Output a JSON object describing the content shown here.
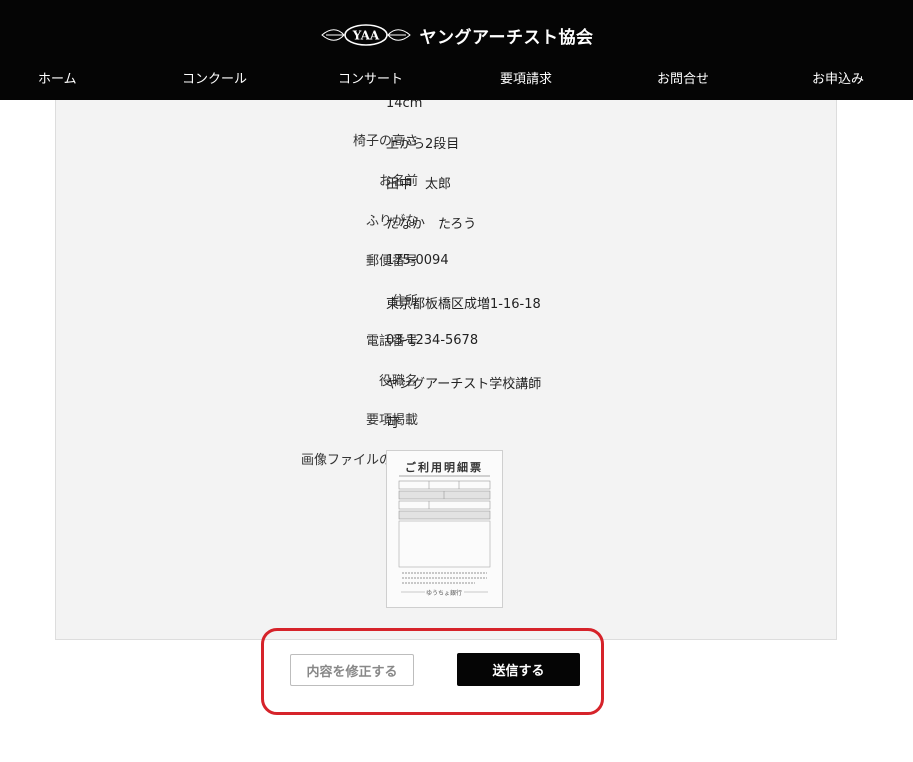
{
  "header": {
    "logo_emblem": "YAA",
    "site_name": "ヤングアーチスト協会"
  },
  "nav": [
    {
      "label": "ホーム",
      "name": "nav-home"
    },
    {
      "label": "コンクール",
      "name": "nav-concours"
    },
    {
      "label": "コンサート",
      "name": "nav-concert"
    },
    {
      "label": "要項請求",
      "name": "nav-guidelines-request"
    },
    {
      "label": "お問合せ",
      "name": "nav-contact"
    },
    {
      "label": "お申込み",
      "name": "nav-apply"
    }
  ],
  "form": {
    "partial_row": {
      "label": "",
      "value": "14cm"
    },
    "rows": [
      {
        "label": "椅子の高さ",
        "value": "上から2段目"
      },
      {
        "label": "お名前",
        "value": "田中　太郎"
      },
      {
        "label": "ふりがな",
        "value": "たなか　たろう"
      },
      {
        "label": "郵便番号",
        "value": "175-0094"
      },
      {
        "label": "住所",
        "value": "東京都板橋区成増1-16-18"
      },
      {
        "label": "電話番号",
        "value": "03-1234-5678"
      },
      {
        "label": "役職名",
        "value": "ヤングアーチスト学校講師"
      },
      {
        "label": "要項掲載",
        "value": "可"
      }
    ],
    "attachment": {
      "label": "画像ファイルの添付",
      "receipt_title": "ご利用明細票",
      "receipt_footer": "ゆうちょ銀行"
    }
  },
  "buttons": {
    "edit_label": "内容を修正する",
    "send_label": "送信する"
  },
  "colors": {
    "header_bg": "#050505",
    "panel_bg": "#f3f3f3",
    "highlight": "#d6232a"
  }
}
